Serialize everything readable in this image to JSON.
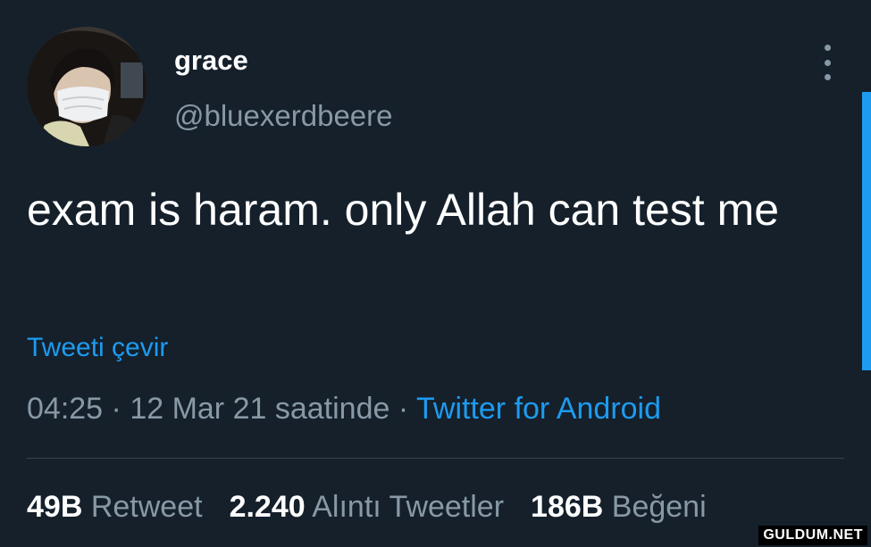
{
  "tweet": {
    "display_name": "grace",
    "handle": "@bluexerdbeere",
    "text": "exam is haram. only Allah can test me",
    "translate_label": "Tweeti çevir",
    "time": "04:25",
    "separator": " · ",
    "date_text": "12 Mar 21 saatinde",
    "source": "Twitter for Android"
  },
  "stats": {
    "retweets": {
      "value": "49B",
      "label": "Retweet"
    },
    "quotes": {
      "value": "2.240",
      "label": "Alıntı Tweetler"
    },
    "likes": {
      "value": "186B",
      "label": "Beğeni"
    }
  },
  "watermark": "GULDUM.NET",
  "icons": {
    "more": "more-vertical-icon",
    "avatar": "user-avatar"
  },
  "colors": {
    "background": "#15202b",
    "primary_text": "#ffffff",
    "secondary_text": "#8899a6",
    "accent": "#1d9bf0",
    "divider": "#38444d"
  }
}
